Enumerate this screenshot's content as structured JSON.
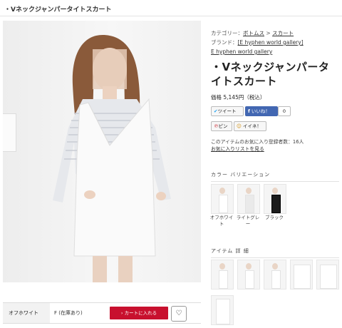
{
  "page": {
    "title": "・Vネックジャンパータイトスカート"
  },
  "product": {
    "category_label": "カテゴリー：",
    "category_1": "ボトムス",
    "category_sep": ">",
    "category_2": "スカート",
    "brand_label": "ブランド：",
    "brand": "[E hyphen world gallery]",
    "brand_link2": "E hyphen world gallery",
    "title": "・Vネックジャンパータイトスカート",
    "price": "価格 5,145円（税込）",
    "tweet": "ツイート",
    "like": "いいね！",
    "like_count": "0",
    "pin": "ピン",
    "iine": "イイネ！",
    "fav_count_text": "このアイテムのお気に入り登録者数：16人",
    "fav_link": "お気に入りリストを見る"
  },
  "colors": {
    "title": "カラー バリエーション",
    "items": [
      {
        "label": "オフホワイト"
      },
      {
        "label": "ライトグレー"
      },
      {
        "label": "ブラック"
      }
    ]
  },
  "details": {
    "title": "アイテム 詳 細"
  },
  "cart_row": {
    "color": "オフホワイト",
    "size": "F (在庫あり)",
    "cart_button": "カートに入れる",
    "heart": "♡"
  },
  "icons": {
    "twitter": "twitter-icon",
    "facebook": "facebook-icon",
    "pinterest": "pinterest-icon",
    "heart": "heart-icon"
  }
}
